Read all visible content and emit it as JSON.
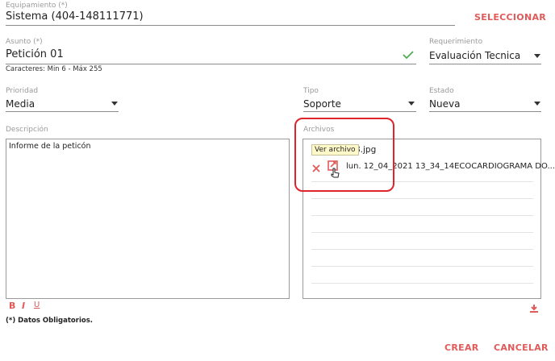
{
  "equipamiento": {
    "label": "Equipamiento (*)",
    "value": "Sistema (404-148111771)",
    "select_button": "SELECCIONAR"
  },
  "asunto": {
    "label": "Asunto (*)",
    "value": "Petición 01",
    "hint": "Caracteres: Min 6 - Máx 255"
  },
  "requerimiento": {
    "label": "Requerimiento",
    "value": "Evaluación Tecnica"
  },
  "prioridad": {
    "label": "Prioridad",
    "value": "Media"
  },
  "tipo": {
    "label": "Tipo",
    "value": "Soporte"
  },
  "estado": {
    "label": "Estado",
    "value": "Nueva"
  },
  "descripcion": {
    "label": "Descripción",
    "value": "Informe de la peticón"
  },
  "archivos": {
    "label": "Archivos",
    "tooltip": "Ver archivo",
    "files": [
      {
        "name": "8.jpg"
      },
      {
        "name": "lun. 12_04_2021 13_34_14ECOCARDIOGRAMA DO..."
      }
    ]
  },
  "toolbar": {
    "bold": "B",
    "italic": "I",
    "underline": "U"
  },
  "footer": {
    "required_note": "(*) Datos Obligatorios.",
    "create": "CREAR",
    "cancel": "CANCELAR"
  },
  "colors": {
    "accent": "#e05a5a",
    "check": "#4caf50",
    "highlight": "#e0242c"
  },
  "icons": {
    "valid": "check-icon",
    "remove": "close-icon",
    "view": "view-file-icon",
    "download": "download-icon",
    "dropdown": "arrow-drop-down-icon"
  }
}
